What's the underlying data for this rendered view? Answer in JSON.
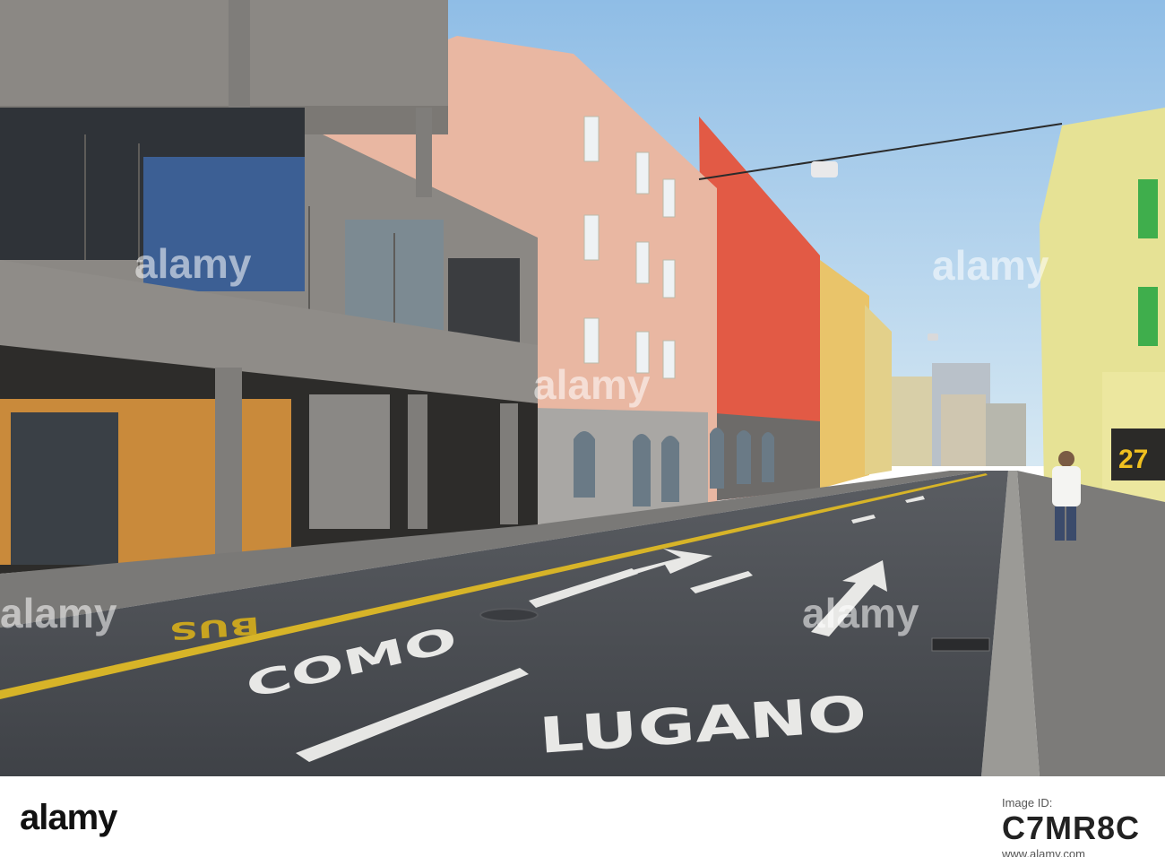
{
  "scene": {
    "description_hidden": "",
    "road_marking_left": "COMO",
    "road_marking_right": "LUGANO",
    "bus_marking": "BUS",
    "sign_number": "27",
    "watermark": "alamy"
  },
  "footer": {
    "logo": "alamy",
    "image_id_label": "Image ID:",
    "image_id": "C7MR8C",
    "url": "www.alamy.com"
  },
  "colors": {
    "sky": "#a9cdea",
    "road": "#4a4d52",
    "concrete": "#8c8a86",
    "salmon_building": "#e8b4a0",
    "red_building": "#e15a45",
    "yellow_building": "#e8e39a"
  }
}
